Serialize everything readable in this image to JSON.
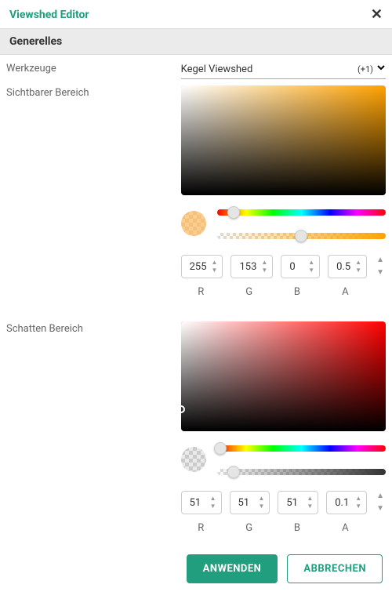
{
  "header": {
    "title": "Viewshed Editor"
  },
  "section": {
    "general": "Generelles"
  },
  "fields": {
    "tools_label": "Werkzeuge",
    "tools_value": "Kegel Viewshed",
    "tools_count": "(+1)",
    "visible_label": "Sichtbarer Bereich",
    "shadow_label": "Schatten Bereich"
  },
  "color_labels": {
    "r": "R",
    "g": "G",
    "b": "B",
    "a": "A"
  },
  "visible_color": {
    "hue_css": "#ffa200",
    "r": "255",
    "g": "153",
    "b": "0",
    "a": "0.5",
    "swatch_css": "rgba(255,178,77,0.65)",
    "alpha_grad_css": "linear-gradient(to right, rgba(255,162,0,0), rgba(255,162,0,1))",
    "sv_cursor_left": "101%",
    "sv_cursor_top": "-1%",
    "hue_knob_left": "10%",
    "alpha_knob_left": "50%"
  },
  "shadow_color": {
    "hue_css": "#ff0000",
    "r": "51",
    "g": "51",
    "b": "51",
    "a": "0.1",
    "swatch_css": "rgba(51,51,51,0.1)",
    "alpha_grad_css": "linear-gradient(to right, rgba(51,51,51,0), rgba(51,51,51,1))",
    "sv_cursor_left": "0%",
    "sv_cursor_top": "80%",
    "hue_knob_left": "2%",
    "alpha_knob_left": "10%"
  },
  "buttons": {
    "apply": "Anwenden",
    "cancel": "Abbrechen"
  }
}
